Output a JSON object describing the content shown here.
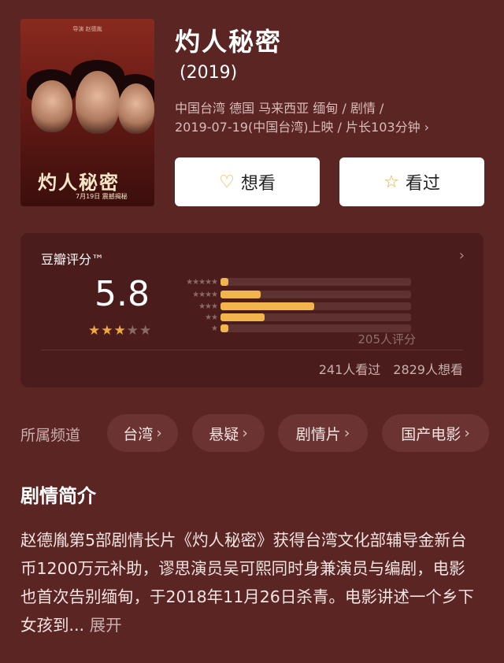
{
  "poster": {
    "title_text": "灼人秘密",
    "date_text": "7月19日 震撼揭秘",
    "credits_text": "导演 赵德胤"
  },
  "movie": {
    "title": "灼人秘密",
    "year": "(2019)",
    "meta_line1": "中国台湾 德国 马来西亚 缅甸 / 剧情 /",
    "meta_line2": "2019-07-19(中国台湾)上映 / 片长103分钟"
  },
  "actions": {
    "want_label": "想看",
    "seen_label": "看过"
  },
  "rating": {
    "label": "豆瓣评分™",
    "score": "5.8",
    "stars_filled": 3,
    "stars_total": 5,
    "distribution": [
      {
        "stars": "★★★★★",
        "percent": 4
      },
      {
        "stars": "★★★★",
        "percent": 21
      },
      {
        "stars": "★★★",
        "percent": 49
      },
      {
        "stars": "★★",
        "percent": 23
      },
      {
        "stars": "★",
        "percent": 4
      }
    ],
    "count": "205人评分",
    "seen": "241人看过",
    "want": "2829人想看"
  },
  "channels": {
    "label": "所属频道",
    "items": [
      "台湾",
      "悬疑",
      "剧情片",
      "国产电影"
    ]
  },
  "synopsis": {
    "title": "剧情简介",
    "text": "赵德胤第5部剧情长片《灼人秘密》获得台湾文化部辅导金新台币1200万元补助，谬思演员吴可熙同时身兼演员与编剧，电影也首次告别缅甸，于2018年11月26日杀青。电影讲述一个乡下女孩到...",
    "more": "展开"
  },
  "colors": {
    "background": "#5a2523",
    "card": "#4a1c1b",
    "accent": "#f2a93b"
  },
  "icons": {
    "want": "heart-plus-icon",
    "seen": "star-outline-icon",
    "chevron": "chevron-right-icon"
  }
}
